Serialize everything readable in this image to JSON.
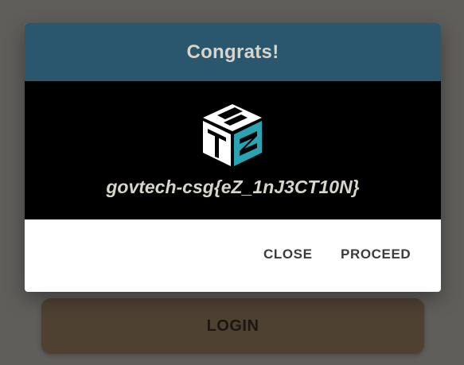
{
  "page": {
    "login_label": "LOGIN"
  },
  "dialog": {
    "title": "Congrats!",
    "logo_icon": "stack-logo-icon",
    "flag": "govtech-csg{eZ_1nJ3CT10N}",
    "actions": {
      "close_label": "CLOSE",
      "proceed_label": "PROCEED"
    }
  },
  "colors": {
    "header_bg": "#2a576d",
    "body_bg": "#000000",
    "accent": "#2aa3b2",
    "overlay": "#5f5e5b",
    "login_bg": "#4e4132"
  }
}
